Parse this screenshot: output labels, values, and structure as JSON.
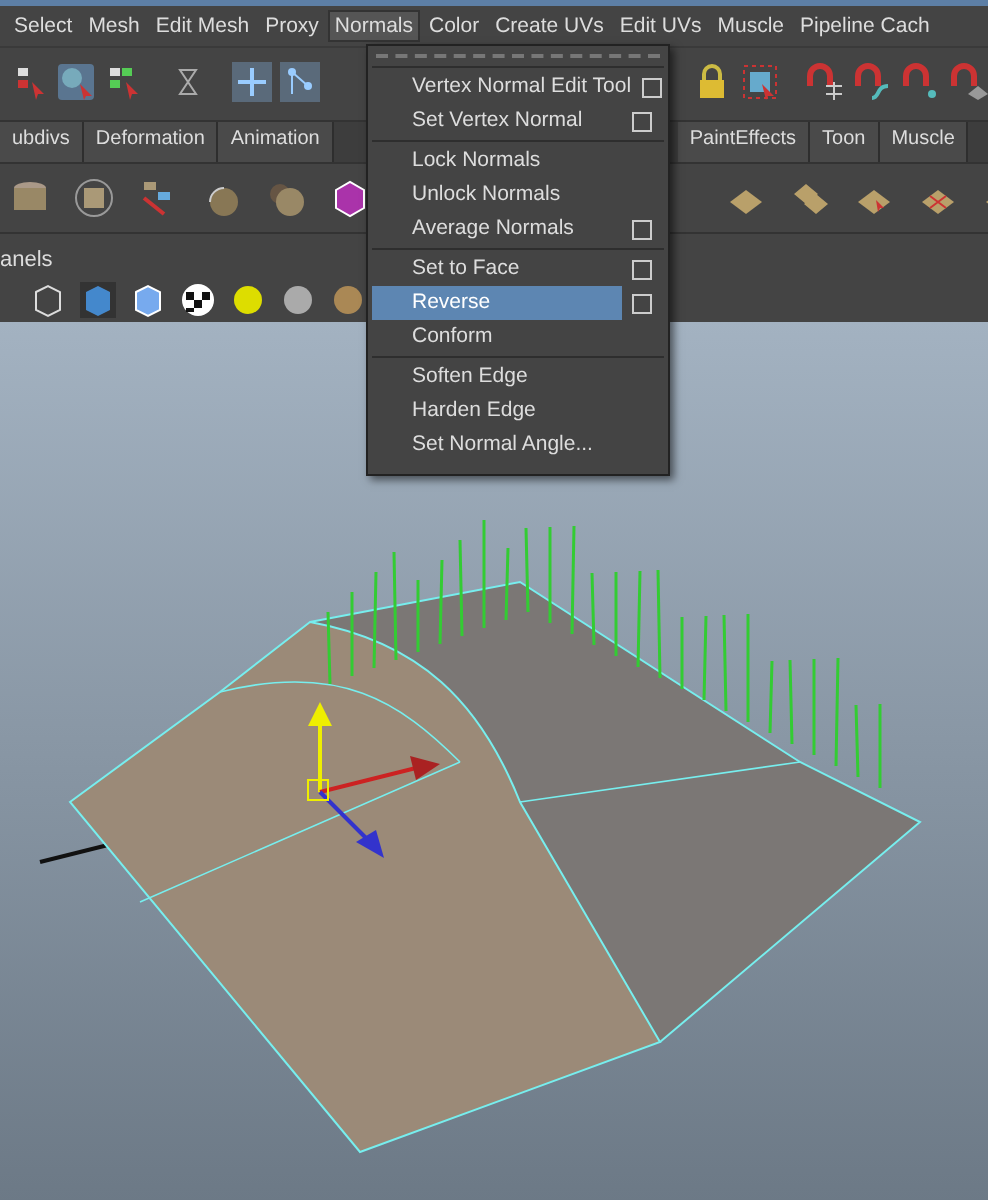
{
  "menubar": [
    {
      "label": "Select",
      "selected": false
    },
    {
      "label": "Mesh",
      "selected": false
    },
    {
      "label": "Edit Mesh",
      "selected": false
    },
    {
      "label": "Proxy",
      "selected": false
    },
    {
      "label": "Normals",
      "selected": true
    },
    {
      "label": "Color",
      "selected": false
    },
    {
      "label": "Create UVs",
      "selected": false
    },
    {
      "label": "Edit UVs",
      "selected": false
    },
    {
      "label": "Muscle",
      "selected": false
    },
    {
      "label": "Pipeline Cach",
      "selected": false
    }
  ],
  "normals_menu": {
    "groups": [
      [
        {
          "label": "Vertex Normal Edit Tool",
          "option_box": true,
          "selected": false
        },
        {
          "label": "Set Vertex Normal",
          "option_box": true,
          "selected": false
        }
      ],
      [
        {
          "label": "Lock Normals",
          "option_box": false,
          "selected": false
        },
        {
          "label": "Unlock Normals",
          "option_box": false,
          "selected": false
        },
        {
          "label": "Average Normals",
          "option_box": true,
          "selected": false
        }
      ],
      [
        {
          "label": "Set to Face",
          "option_box": true,
          "selected": false
        },
        {
          "label": "Reverse",
          "option_box": true,
          "selected": true
        },
        {
          "label": "Conform",
          "option_box": false,
          "selected": false
        }
      ],
      [
        {
          "label": "Soften Edge",
          "option_box": false,
          "selected": false
        },
        {
          "label": "Harden Edge",
          "option_box": false,
          "selected": false
        },
        {
          "label": "Set Normal Angle...",
          "option_box": false,
          "selected": false
        }
      ]
    ]
  },
  "shelf_tabs": [
    {
      "label": "ubdivs"
    },
    {
      "label": "Deformation"
    },
    {
      "label": "Animation"
    },
    {
      "label": "PaintEffects"
    },
    {
      "label": "Toon"
    },
    {
      "label": "Muscle"
    }
  ],
  "panel": {
    "title": "anels"
  }
}
